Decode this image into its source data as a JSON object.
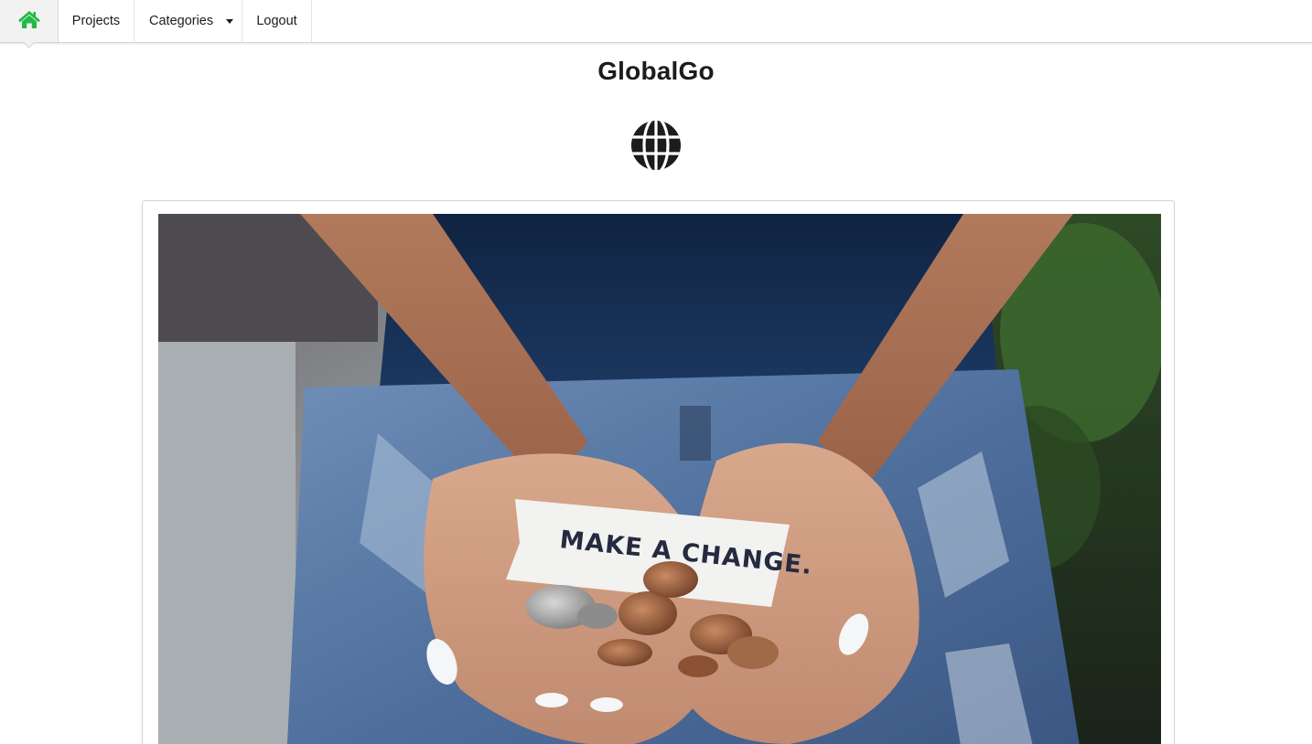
{
  "nav": {
    "home_icon": "home-icon",
    "projects": "Projects",
    "categories": "Categories",
    "logout": "Logout"
  },
  "header": {
    "title": "GlobalGo",
    "logo_icon": "globe-icon"
  },
  "hero": {
    "note_text": "MAKE A CHANGE."
  },
  "colors": {
    "accent": "#21ba45",
    "text": "#1b1c1d",
    "border": "#d4d4d5"
  }
}
